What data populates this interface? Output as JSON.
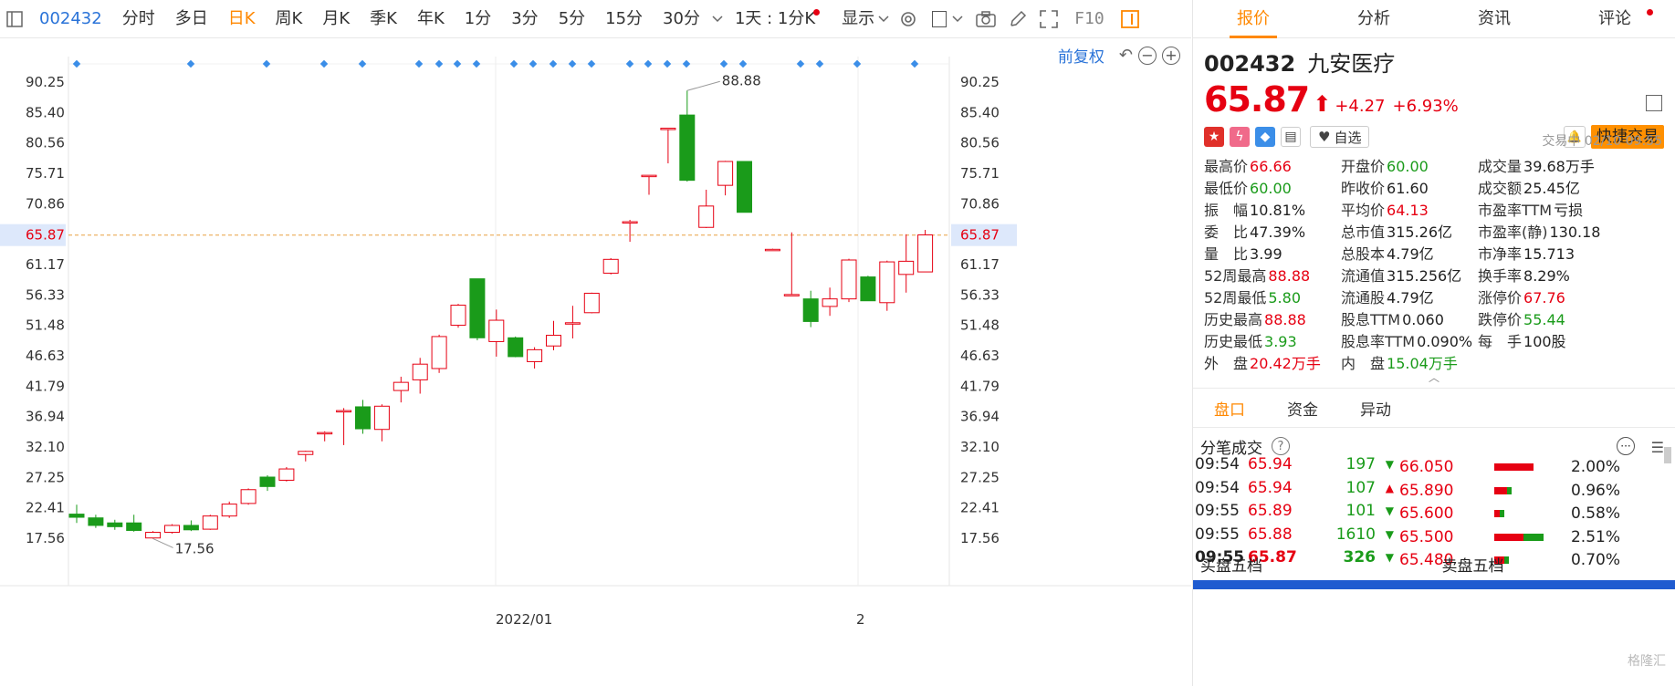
{
  "toolbar": {
    "code": "002432",
    "periods": [
      "分时",
      "多日",
      "日K",
      "周K",
      "月K",
      "季K",
      "年K",
      "1分",
      "3分",
      "5分",
      "15分",
      "30分"
    ],
    "active_period": "日K",
    "combo_label": "1天 : 1分K",
    "display_label": "显示",
    "f10_label": "F10"
  },
  "chart_tools": {
    "adjust_label": "前复权"
  },
  "chart_data": {
    "type": "candlestick",
    "y_ticks": [
      "90.25",
      "85.40",
      "80.56",
      "75.71",
      "70.86",
      "65.87",
      "61.17",
      "56.33",
      "51.48",
      "46.63",
      "41.79",
      "36.94",
      "32.10",
      "27.25",
      "22.41",
      "17.56"
    ],
    "y_min": 17.56,
    "y_max": 90.25,
    "current_price": 65.87,
    "x_labels": [
      "2022/01",
      "2"
    ],
    "high_annotation": "88.88",
    "low_annotation": "17.56",
    "candles": [
      {
        "o": 21.4,
        "c": 20.9,
        "h": 22.9,
        "l": 20.0
      },
      {
        "o": 20.8,
        "c": 19.6,
        "h": 21.3,
        "l": 19.2
      },
      {
        "o": 20.0,
        "c": 19.4,
        "h": 20.5,
        "l": 18.9
      },
      {
        "o": 20.0,
        "c": 18.8,
        "h": 21.3,
        "l": 18.6
      },
      {
        "o": 17.6,
        "c": 18.5,
        "h": 18.7,
        "l": 17.5
      },
      {
        "o": 18.5,
        "c": 19.6,
        "h": 19.8,
        "l": 18.3
      },
      {
        "o": 19.6,
        "c": 18.9,
        "h": 20.4,
        "l": 18.7
      },
      {
        "o": 19.0,
        "c": 21.1,
        "h": 21.3,
        "l": 18.9
      },
      {
        "o": 21.1,
        "c": 23.0,
        "h": 23.4,
        "l": 20.8
      },
      {
        "o": 23.1,
        "c": 25.3,
        "h": 25.5,
        "l": 22.9
      },
      {
        "o": 27.3,
        "c": 25.8,
        "h": 27.6,
        "l": 25.1
      },
      {
        "o": 26.8,
        "c": 28.6,
        "h": 28.9,
        "l": 26.6
      },
      {
        "o": 30.9,
        "c": 31.4,
        "h": 31.5,
        "l": 29.8
      },
      {
        "o": 34.4,
        "c": 34.4,
        "h": 34.6,
        "l": 33.0
      },
      {
        "o": 37.9,
        "c": 37.9,
        "h": 38.3,
        "l": 32.4
      },
      {
        "o": 38.5,
        "c": 35.0,
        "h": 39.6,
        "l": 34.2
      },
      {
        "o": 34.9,
        "c": 38.6,
        "h": 38.9,
        "l": 33.0
      },
      {
        "o": 41.1,
        "c": 42.4,
        "h": 43.3,
        "l": 39.2
      },
      {
        "o": 42.8,
        "c": 45.3,
        "h": 46.3,
        "l": 40.6
      },
      {
        "o": 44.6,
        "c": 49.7,
        "h": 50.0,
        "l": 43.9
      },
      {
        "o": 51.5,
        "c": 54.7,
        "h": 54.9,
        "l": 51.1
      },
      {
        "o": 58.9,
        "c": 49.5,
        "h": 58.9,
        "l": 49.1
      },
      {
        "o": 48.9,
        "c": 52.3,
        "h": 54.0,
        "l": 46.5
      },
      {
        "o": 49.5,
        "c": 46.5,
        "h": 49.7,
        "l": 46.4
      },
      {
        "o": 45.7,
        "c": 47.6,
        "h": 48.0,
        "l": 44.6
      },
      {
        "o": 48.2,
        "c": 49.9,
        "h": 52.2,
        "l": 47.5
      },
      {
        "o": 51.7,
        "c": 51.9,
        "h": 54.6,
        "l": 49.4
      },
      {
        "o": 53.5,
        "c": 56.6,
        "h": 56.7,
        "l": 53.4
      },
      {
        "o": 59.8,
        "c": 62.0,
        "h": 62.2,
        "l": 59.6
      },
      {
        "o": 68.0,
        "c": 68.0,
        "h": 68.3,
        "l": 64.8
      },
      {
        "o": 75.4,
        "c": 75.4,
        "h": 75.4,
        "l": 72.3
      },
      {
        "o": 82.9,
        "c": 82.9,
        "h": 82.9,
        "l": 77.3
      },
      {
        "o": 85.0,
        "c": 74.6,
        "h": 88.9,
        "l": 74.4
      },
      {
        "o": 67.1,
        "c": 70.5,
        "h": 73.1,
        "l": 67.0
      },
      {
        "o": 73.8,
        "c": 77.6,
        "h": 77.7,
        "l": 72.2
      },
      {
        "o": 77.6,
        "c": 69.5,
        "h": 77.6,
        "l": 69.5
      },
      {
        "o": 63.6,
        "c": 63.6,
        "h": 63.7,
        "l": 63.4
      },
      {
        "o": 56.4,
        "c": 56.4,
        "h": 66.3,
        "l": 56.2
      },
      {
        "o": 55.7,
        "c": 52.1,
        "h": 57.0,
        "l": 51.2
      },
      {
        "o": 54.5,
        "c": 55.7,
        "h": 57.5,
        "l": 53.0
      },
      {
        "o": 55.7,
        "c": 61.9,
        "h": 62.1,
        "l": 55.2
      },
      {
        "o": 59.2,
        "c": 55.4,
        "h": 59.4,
        "l": 55.4
      },
      {
        "o": 55.1,
        "c": 61.6,
        "h": 61.8,
        "l": 53.8
      },
      {
        "o": 59.6,
        "c": 61.7,
        "h": 66.0,
        "l": 56.7
      },
      {
        "o": 60.0,
        "c": 65.9,
        "h": 66.7,
        "l": 60.0
      }
    ]
  },
  "tabs": [
    "报价",
    "分析",
    "资讯",
    "评论"
  ],
  "active_tab": "报价",
  "stock": {
    "code": "002432",
    "name": "九安医疗",
    "price": "65.87",
    "arrow": "⬆",
    "change": "+4.27",
    "change_pct": "+6.93%",
    "status": "交易中 02/10 09:55",
    "watch_label": "自选",
    "trade_label": "快捷交易"
  },
  "quote": [
    {
      "label": "最高价",
      "value": "66.66",
      "cls": "up"
    },
    {
      "label": "开盘价",
      "value": "60.00",
      "cls": "dn"
    },
    {
      "label": "成交量",
      "value": "39.68万手",
      "cls": "nt"
    },
    {
      "label": "最低价",
      "value": "60.00",
      "cls": "dn"
    },
    {
      "label": "昨收价",
      "value": "61.60",
      "cls": "nt"
    },
    {
      "label": "成交额",
      "value": "25.45亿",
      "cls": "nt"
    },
    {
      "label": "振　幅",
      "value": "10.81%",
      "cls": "nt"
    },
    {
      "label": "平均价",
      "value": "64.13",
      "cls": "up"
    },
    {
      "label": "市盈率TTM",
      "value": "亏损",
      "cls": "nt"
    },
    {
      "label": "委　比",
      "value": "47.39%",
      "cls": "nt"
    },
    {
      "label": "总市值",
      "value": "315.26亿",
      "cls": "nt"
    },
    {
      "label": "市盈率(静)",
      "value": "130.18",
      "cls": "nt"
    },
    {
      "label": "量　比",
      "value": "3.99",
      "cls": "nt"
    },
    {
      "label": "总股本",
      "value": "4.79亿",
      "cls": "nt"
    },
    {
      "label": "市净率",
      "value": "15.713",
      "cls": "nt"
    },
    {
      "label": "52周最高",
      "value": "88.88",
      "cls": "up"
    },
    {
      "label": "流通值",
      "value": "315.256亿",
      "cls": "nt"
    },
    {
      "label": "换手率",
      "value": "8.29%",
      "cls": "nt"
    },
    {
      "label": "52周最低",
      "value": "5.80",
      "cls": "dn"
    },
    {
      "label": "流通股",
      "value": "4.79亿",
      "cls": "nt"
    },
    {
      "label": "涨停价",
      "value": "67.76",
      "cls": "up"
    },
    {
      "label": "历史最高",
      "value": "88.88",
      "cls": "up"
    },
    {
      "label": "股息TTM",
      "value": "0.060",
      "cls": "nt"
    },
    {
      "label": "跌停价",
      "value": "55.44",
      "cls": "dn"
    },
    {
      "label": "历史最低",
      "value": "3.93",
      "cls": "dn"
    },
    {
      "label": "股息率TTM",
      "value": "0.090%",
      "cls": "nt"
    },
    {
      "label": "每　手",
      "value": "100股",
      "cls": "nt"
    },
    {
      "label": "外　盘",
      "value": "20.42万手",
      "cls": "up"
    },
    {
      "label": "内　盘",
      "value": "15.04万手",
      "cls": "dn"
    },
    {
      "label": "",
      "value": "",
      "cls": "nt"
    }
  ],
  "subtabs": [
    "盘口",
    "资金",
    "异动"
  ],
  "active_subtab": "盘口",
  "trades_title": "分笔成交",
  "ticks": [
    {
      "time": "09:54",
      "price": "65.94",
      "vol": "197",
      "dir": "▼",
      "dc": "dn"
    },
    {
      "time": "09:54",
      "price": "65.94",
      "vol": "107",
      "dir": "▲",
      "dc": "up"
    },
    {
      "time": "09:55",
      "price": "65.89",
      "vol": "101",
      "dir": "▼",
      "dc": "dn"
    },
    {
      "time": "09:55",
      "price": "65.88",
      "vol": "1610",
      "dir": "▼",
      "dc": "dn"
    },
    {
      "time": "09:55",
      "price": "65.87",
      "vol": "326",
      "dir": "▼",
      "dc": "dn"
    }
  ],
  "orders": [
    {
      "price": "66.050",
      "pct": "2.00%",
      "red": 0.8,
      "green": 0.0
    },
    {
      "price": "65.890",
      "pct": "0.96%",
      "red": 0.25,
      "green": 0.1
    },
    {
      "price": "65.600",
      "pct": "0.58%",
      "red": 0.12,
      "green": 0.08
    },
    {
      "price": "65.500",
      "pct": "2.51%",
      "red": 0.6,
      "green": 0.4
    },
    {
      "price": "65.480",
      "pct": "0.70%",
      "red": 0.2,
      "green": 0.1
    }
  ],
  "book": {
    "buy": "买盘五档",
    "sell": "卖盘五档"
  },
  "colors": {
    "up": "#e60012",
    "down": "#1a9b1a",
    "accent": "#ff8800",
    "link": "#2a73d8"
  },
  "watermark": "格隆汇"
}
